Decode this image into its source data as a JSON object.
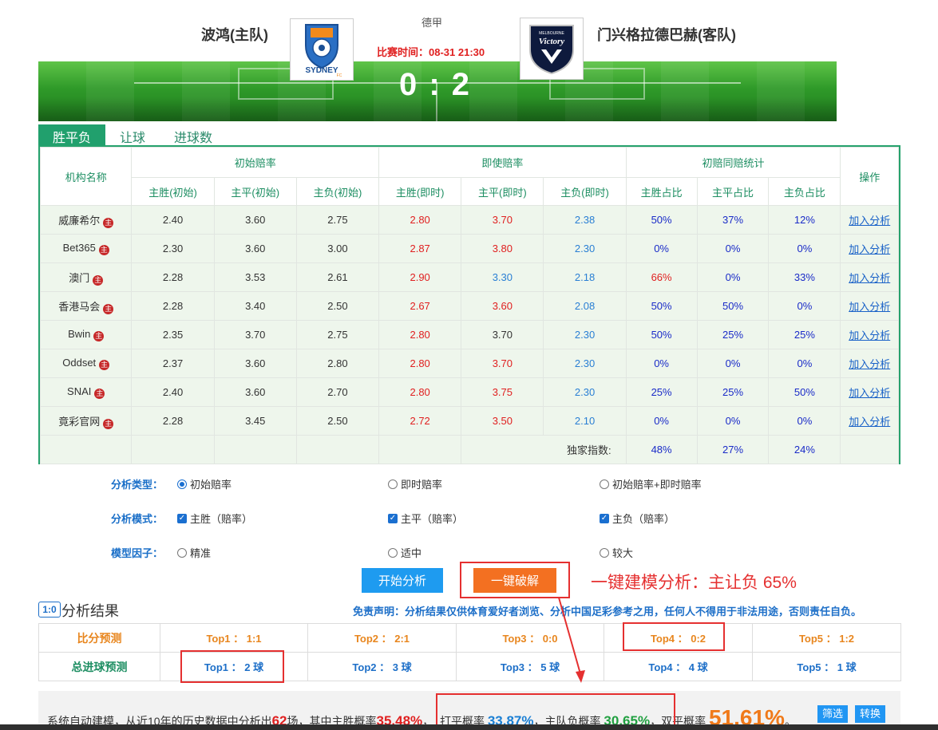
{
  "match": {
    "home_team": "波鸿(主队)",
    "away_team": "门兴格拉德巴赫(客队)",
    "league": "德甲",
    "time": "比赛时间：08-31 21:30",
    "score": "0 : 2",
    "home_logo_text": "SYDNEY",
    "home_logo_sub": "FC",
    "away_logo_text": "Victory",
    "away_logo_top": "MELBOURNE"
  },
  "tabs": [
    "胜平负",
    "让球",
    "进球数"
  ],
  "odds_table": {
    "header": {
      "bookmaker": "机构名称",
      "initial": "初始赔率",
      "live": "即使赔率",
      "stats": "初赔同赔统计",
      "action": "操作"
    },
    "subheaders": [
      "主胜(初始)",
      "主平(初始)",
      "主负(初始)",
      "主胜(即时)",
      "主平(即时)",
      "主负(即时)",
      "主胜占比",
      "主平占比",
      "主负占比"
    ],
    "zhu_label": "主",
    "rows": [
      {
        "name": "威廉希尔",
        "init": [
          "2.40",
          "3.60",
          "2.75"
        ],
        "live": [
          "2.80",
          "3.70",
          "2.38"
        ],
        "live_colors": [
          "red",
          "red",
          "blue"
        ],
        "pct": [
          "50%",
          "37%",
          "12%"
        ],
        "pct_red": [
          false,
          false,
          false
        ],
        "action": "加入分析"
      },
      {
        "name": "Bet365",
        "init": [
          "2.30",
          "3.60",
          "3.00"
        ],
        "live": [
          "2.87",
          "3.80",
          "2.30"
        ],
        "live_colors": [
          "red",
          "red",
          "blue"
        ],
        "pct": [
          "0%",
          "0%",
          "0%"
        ],
        "pct_red": [
          false,
          false,
          false
        ],
        "action": "加入分析"
      },
      {
        "name": "澳门",
        "init": [
          "2.28",
          "3.53",
          "2.61"
        ],
        "live": [
          "2.90",
          "3.30",
          "2.18"
        ],
        "live_colors": [
          "red",
          "blue",
          "blue"
        ],
        "pct": [
          "66%",
          "0%",
          "33%"
        ],
        "pct_red": [
          true,
          false,
          false
        ],
        "action": "加入分析"
      },
      {
        "name": "香港马会",
        "init": [
          "2.28",
          "3.40",
          "2.50"
        ],
        "live": [
          "2.67",
          "3.60",
          "2.08"
        ],
        "live_colors": [
          "red",
          "red",
          "blue"
        ],
        "pct": [
          "50%",
          "50%",
          "0%"
        ],
        "pct_red": [
          false,
          false,
          false
        ],
        "action": "加入分析"
      },
      {
        "name": "Bwin",
        "init": [
          "2.35",
          "3.70",
          "2.75"
        ],
        "live": [
          "2.80",
          "3.70",
          "2.30"
        ],
        "live_colors": [
          "red",
          "black",
          "blue"
        ],
        "pct": [
          "50%",
          "25%",
          "25%"
        ],
        "pct_red": [
          false,
          false,
          false
        ],
        "action": "加入分析"
      },
      {
        "name": "Oddset",
        "init": [
          "2.37",
          "3.60",
          "2.80"
        ],
        "live": [
          "2.80",
          "3.70",
          "2.30"
        ],
        "live_colors": [
          "red",
          "red",
          "blue"
        ],
        "pct": [
          "0%",
          "0%",
          "0%"
        ],
        "pct_red": [
          false,
          false,
          false
        ],
        "action": "加入分析"
      },
      {
        "name": "SNAI",
        "init": [
          "2.40",
          "3.60",
          "2.70"
        ],
        "live": [
          "2.80",
          "3.75",
          "2.30"
        ],
        "live_colors": [
          "red",
          "red",
          "blue"
        ],
        "pct": [
          "25%",
          "25%",
          "50%"
        ],
        "pct_red": [
          false,
          false,
          false
        ],
        "action": "加入分析"
      },
      {
        "name": "竟彩官网",
        "init": [
          "2.28",
          "3.45",
          "2.50"
        ],
        "live": [
          "2.72",
          "3.50",
          "2.10"
        ],
        "live_colors": [
          "red",
          "red",
          "blue"
        ],
        "pct": [
          "0%",
          "0%",
          "0%"
        ],
        "pct_red": [
          false,
          false,
          false
        ],
        "action": "加入分析"
      }
    ],
    "exclusive_label": "独家指数:",
    "exclusive": [
      "48%",
      "27%",
      "24%"
    ]
  },
  "analysis": {
    "type_label": "分析类型：",
    "type_options": [
      "初始赔率",
      "即时赔率",
      "初始赔率+即时赔率"
    ],
    "type_selected": 0,
    "mode_label": "分析模式：",
    "mode_options": [
      "主胜（赔率）",
      "主平（赔率）",
      "主负（赔率）"
    ],
    "factor_label": "模型因子：",
    "factor_options": [
      "精准",
      "适中",
      "较大"
    ],
    "start_button": "开始分析",
    "crack_button": "一键破解",
    "annotation": "一键建模分析：主让负 65%"
  },
  "results": {
    "icon": "1:0",
    "title": "分析结果",
    "disclaimer": "免责声明：分析结果仅供体育爱好者浏览、分析中国足彩参考之用，任何人不得用于非法用途，否则责任自负。",
    "score_label": "比分预测",
    "scores": [
      "Top1 ： 1:1",
      "Top2 ： 2:1",
      "Top3 ： 0:0",
      "Top4 ： 0:2",
      "Top5 ： 1:2"
    ],
    "goals_label": "总进球预测",
    "goals": [
      "Top1 ： 2 球",
      "Top2 ： 3 球",
      "Top3 ： 5 球",
      "Top4 ： 4 球",
      "Top5 ： 1 球"
    ]
  },
  "summary": {
    "prefix": "系统自动建模，从近10年的历史数据中分析出",
    "match_count": "62",
    "mid1": "场，其中主胜概率",
    "home_win": "35.48%",
    "mid2": "，",
    "draw_label": "打平概率",
    "draw": "33.87%",
    "mid3": "，主队负概率",
    "home_loss": "30.65%",
    "mid4": "，双平概率",
    "double_draw": "51.61%",
    "tail": "。",
    "filter_button": "筛选",
    "convert_button": "转换"
  }
}
